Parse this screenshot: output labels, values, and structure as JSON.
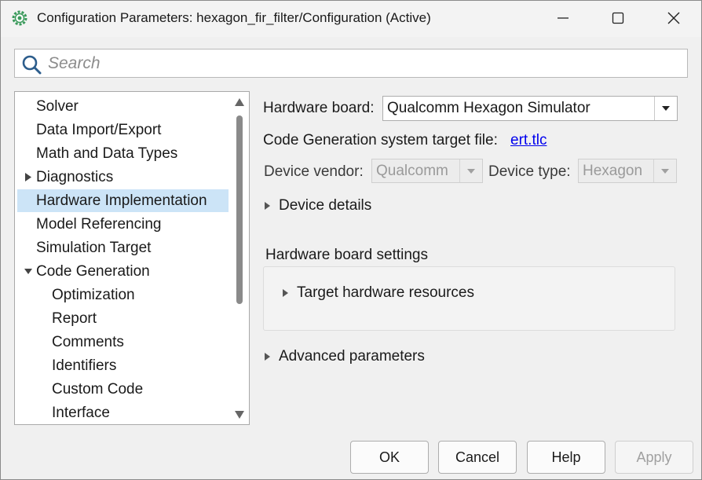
{
  "window": {
    "title": "Configuration Parameters: hexagon_fir_filter/Configuration (Active)",
    "app_icon": "gear-icon",
    "controls": [
      "minimize-icon",
      "maximize-icon",
      "close-icon"
    ]
  },
  "search": {
    "placeholder": "Search",
    "value": ""
  },
  "tree": {
    "items": [
      {
        "label": "Solver",
        "level": 0,
        "expandable": false
      },
      {
        "label": "Data Import/Export",
        "level": 0,
        "expandable": false
      },
      {
        "label": "Math and Data Types",
        "level": 0,
        "expandable": false
      },
      {
        "label": "Diagnostics",
        "level": 0,
        "expandable": true,
        "expanded": false
      },
      {
        "label": "Hardware Implementation",
        "level": 0,
        "expandable": false,
        "selected": true
      },
      {
        "label": "Model Referencing",
        "level": 0,
        "expandable": false
      },
      {
        "label": "Simulation Target",
        "level": 0,
        "expandable": false
      },
      {
        "label": "Code Generation",
        "level": 0,
        "expandable": true,
        "expanded": true
      },
      {
        "label": "Optimization",
        "level": 1,
        "expandable": false
      },
      {
        "label": "Report",
        "level": 1,
        "expandable": false
      },
      {
        "label": "Comments",
        "level": 1,
        "expandable": false
      },
      {
        "label": "Identifiers",
        "level": 1,
        "expandable": false
      },
      {
        "label": "Custom Code",
        "level": 1,
        "expandable": false
      },
      {
        "label": "Interface",
        "level": 1,
        "expandable": false
      }
    ]
  },
  "hardware": {
    "board_label": "Hardware board:",
    "board_value": "Qualcomm Hexagon Simulator",
    "target_file_label": "Code Generation system target file:",
    "target_file_link": "ert.tlc",
    "vendor_label": "Device vendor:",
    "vendor_value": "Qualcomm",
    "type_label": "Device type:",
    "type_value": "Hexagon",
    "device_details": "Device details",
    "board_settings_label": "Hardware board settings",
    "target_resources": "Target hardware resources",
    "advanced_params": "Advanced parameters"
  },
  "buttons": {
    "ok": "OK",
    "cancel": "Cancel",
    "help": "Help",
    "apply": "Apply"
  },
  "colors": {
    "selection": "#cce4f7",
    "link": "#0000ee",
    "app_icon_green": "#3a9a5b"
  }
}
